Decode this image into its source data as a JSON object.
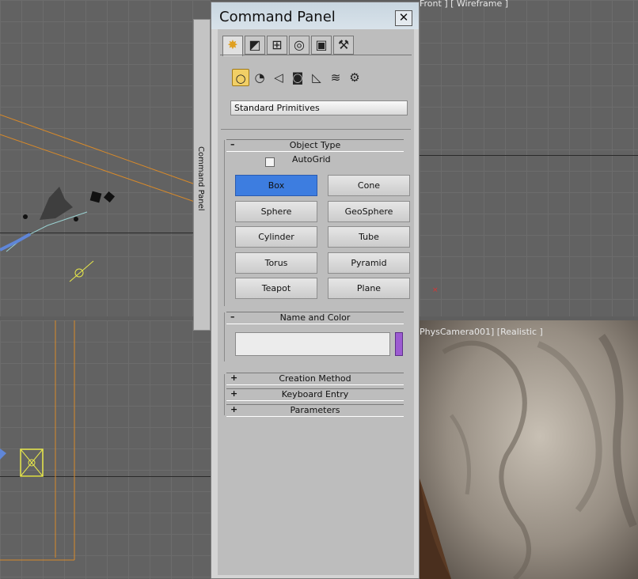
{
  "viewports": {
    "front": {
      "label": "Front ] [ Wireframe ]"
    },
    "camera": {
      "label": "PhysCamera001] [Realistic ]"
    }
  },
  "side_tab": {
    "label": "Command Panel"
  },
  "panel": {
    "title": "Command Panel",
    "close_glyph": "✕",
    "tabs": [
      {
        "name": "create",
        "glyph": "✸",
        "active": true
      },
      {
        "name": "modify",
        "glyph": "◩",
        "active": false
      },
      {
        "name": "hierarchy",
        "glyph": "⊞",
        "active": false
      },
      {
        "name": "motion",
        "glyph": "◎",
        "active": false
      },
      {
        "name": "display",
        "glyph": "▣",
        "active": false
      },
      {
        "name": "utilities",
        "glyph": "⚒",
        "active": false
      }
    ],
    "categories": [
      {
        "name": "geometry",
        "glyph": "○",
        "active": true
      },
      {
        "name": "shapes",
        "glyph": "◔",
        "active": false
      },
      {
        "name": "lights",
        "glyph": "◁",
        "active": false
      },
      {
        "name": "cameras",
        "glyph": "◙",
        "active": false
      },
      {
        "name": "helpers",
        "glyph": "◺",
        "active": false
      },
      {
        "name": "space-warps",
        "glyph": "≋",
        "active": false
      },
      {
        "name": "systems",
        "glyph": "⚙",
        "active": false
      }
    ],
    "dropdown_value": "Standard Primitives",
    "object_type": {
      "sign": "–",
      "title": "Object Type",
      "autogrid_label": "AutoGrid",
      "buttons": [
        "Box",
        "Cone",
        "Sphere",
        "GeoSphere",
        "Cylinder",
        "Tube",
        "Torus",
        "Pyramid",
        "Teapot",
        "Plane"
      ],
      "selected": "Box"
    },
    "name_and_color": {
      "sign": "–",
      "title": "Name and Color",
      "name_value": "",
      "color": "#9c5bd1"
    },
    "collapsed_rollouts": [
      {
        "sign": "+",
        "title": "Creation Method"
      },
      {
        "sign": "+",
        "title": "Keyboard Entry"
      },
      {
        "sign": "+",
        "title": "Parameters"
      }
    ]
  },
  "colors": {
    "selected_button": "#3d7de0",
    "orange_guide": "#d88a2a",
    "yellow_helper": "#e8e84a"
  }
}
